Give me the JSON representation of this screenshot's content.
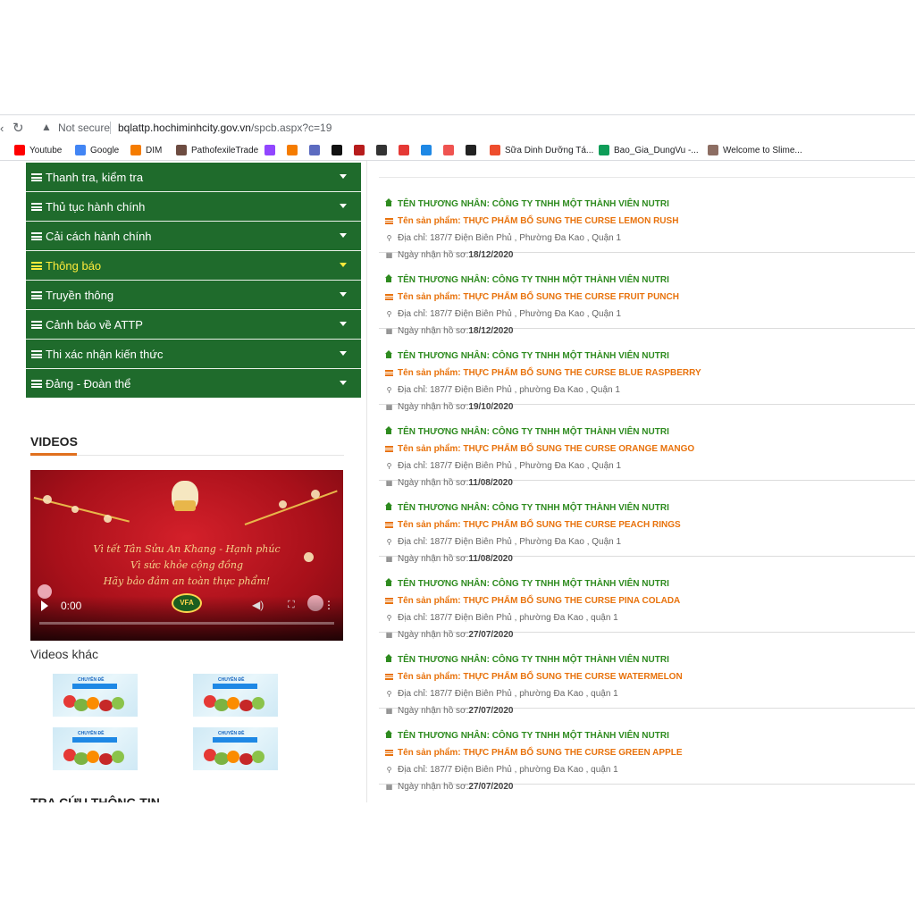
{
  "browser": {
    "not_secure": "Not secure",
    "url_host": "bqlattp.hochiminhcity.gov.vn",
    "url_path": "/spcb.aspx?c=19",
    "bookmarks": [
      {
        "label": "Youtube",
        "icon": "youtube-icon",
        "color": "#ff0000"
      },
      {
        "label": "Google",
        "icon": "google-icon",
        "color": "#4285f4"
      },
      {
        "label": "DIM",
        "icon": "dim-icon",
        "color": "#f57c00"
      },
      {
        "label": "PathofexileTrade",
        "icon": "poe-icon",
        "color": "#6d4c41"
      },
      {
        "label": "",
        "icon": "twitch-icon",
        "color": "#9146ff"
      },
      {
        "label": "",
        "icon": "g-icon",
        "color": "#f57c00"
      },
      {
        "label": "",
        "icon": "app-icon",
        "color": "#5c6bc0"
      },
      {
        "label": "",
        "icon": "c-icon",
        "color": "#111111"
      },
      {
        "label": "",
        "icon": "netflix-icon",
        "color": "#b71c1c"
      },
      {
        "label": "",
        "icon": "eye-icon",
        "color": "#333333"
      },
      {
        "label": "",
        "icon": "circle-icon",
        "color": "#e53935"
      },
      {
        "label": "",
        "icon": "h-icon",
        "color": "#1e88e5"
      },
      {
        "label": "",
        "icon": "shop-icon",
        "color": "#ef5350"
      },
      {
        "label": "",
        "icon": "github-icon",
        "color": "#222222"
      },
      {
        "label": "Sữa Dinh Dưỡng Tá...",
        "icon": "shopee-icon",
        "color": "#ee4d2d"
      },
      {
        "label": "Bao_Gia_DungVu -...",
        "icon": "sheets-icon",
        "color": "#0f9d58"
      },
      {
        "label": "Welcome to Slime...",
        "icon": "slime-icon",
        "color": "#8d6e63"
      }
    ]
  },
  "menu": [
    {
      "label": "Thanh tra, kiểm tra",
      "active": false
    },
    {
      "label": "Thủ tục hành chính",
      "active": false
    },
    {
      "label": "Cải cách hành chính",
      "active": false
    },
    {
      "label": "Thông báo",
      "active": true
    },
    {
      "label": "Truyền thông",
      "active": false
    },
    {
      "label": "Cảnh báo về ATTP",
      "active": false
    },
    {
      "label": "Thi xác nhận kiến thức",
      "active": false
    },
    {
      "label": "Đảng - Đoàn thể",
      "active": false
    }
  ],
  "videos": {
    "title": "VIDEOS",
    "video_lines": [
      "Vì tết Tân Sửu An Khang - Hạnh phúc",
      "Vì sức khỏe cộng đồng",
      "Hãy bảo đảm an toàn thực phẩm!"
    ],
    "time": "0:00",
    "logo": "VFA",
    "other_label": "Videos khác",
    "thumb_title": "CHUYÊN ĐỀ"
  },
  "lookup_title": "TRA CỨU THÔNG TIN",
  "entries": [
    {
      "merchant": "TÊN THƯƠNG NHÂN: CÔNG TY TNHH MỘT THÀNH VIÊN NUTRI",
      "product": "Tên sản phẩm: THỰC PHẨM BỔ SUNG THE CURSE LEMON RUSH",
      "address": "Địa chỉ: 187/7 Điện Biên Phủ , Phường Đa Kao , Quận 1",
      "date_label": "Ngày nhận hồ sơ: ",
      "date": "18/12/2020"
    },
    {
      "merchant": "TÊN THƯƠNG NHÂN: CÔNG TY TNHH MỘT THÀNH VIÊN NUTRI",
      "product": "Tên sản phẩm: THỰC PHẨM BỔ SUNG THE CURSE FRUIT PUNCH",
      "address": "Địa chỉ: 187/7 Điện Biên Phủ , Phường Đa Kao , Quận 1",
      "date_label": "Ngày nhận hồ sơ: ",
      "date": "18/12/2020"
    },
    {
      "merchant": "TÊN THƯƠNG NHÂN: CÔNG TY TNHH MỘT THÀNH VIÊN NUTRI",
      "product": "Tên sản phẩm: THỰC PHẨM BỔ SUNG THE CURSE BLUE RASPBERRY",
      "address": "Địa chỉ: 187/7 Điện Biên Phủ , phường Đa Kao , Quận 1",
      "date_label": "Ngày nhận hồ sơ: ",
      "date": "19/10/2020"
    },
    {
      "merchant": "TÊN THƯƠNG NHÂN: CÔNG TY TNHH MỘT THÀNH VIÊN NUTRI",
      "product": "Tên sản phẩm: THỰC PHẨM BỔ SUNG THE CURSE ORANGE MANGO",
      "address": "Địa chỉ: 187/7 Điện Biên Phủ , Phường Đa Kao , Quận 1",
      "date_label": "Ngày nhận hồ sơ: ",
      "date": "11/08/2020"
    },
    {
      "merchant": "TÊN THƯƠNG NHÂN: CÔNG TY TNHH MỘT THÀNH VIÊN NUTRI",
      "product": "Tên sản phẩm: THỰC PHẨM BỔ SUNG THE CURSE PEACH RINGS",
      "address": "Địa chỉ: 187/7 Điện Biên Phủ , Phường Đa Kao , Quận 1",
      "date_label": "Ngày nhận hồ sơ: ",
      "date": "11/08/2020"
    },
    {
      "merchant": "TÊN THƯƠNG NHÂN: CÔNG TY TNHH MỘT THÀNH VIÊN NUTRI",
      "product": "Tên sản phẩm: THỰC PHẨM BỔ SUNG THE CURSE PINA COLADA",
      "address": "Địa chỉ: 187/7 Điện Biên Phủ , phường Đa Kao , quận 1",
      "date_label": "Ngày nhận hồ sơ: ",
      "date": "27/07/2020"
    },
    {
      "merchant": "TÊN THƯƠNG NHÂN: CÔNG TY TNHH MỘT THÀNH VIÊN NUTRI",
      "product": "Tên sản phẩm: THỰC PHẨM BỔ SUNG THE CURSE WATERMELON",
      "address": "Địa chỉ: 187/7 Điện Biên Phủ , phường Đa Kao , quận 1",
      "date_label": "Ngày nhận hồ sơ: ",
      "date": "27/07/2020"
    },
    {
      "merchant": "TÊN THƯƠNG NHÂN: CÔNG TY TNHH MỘT THÀNH VIÊN NUTRI",
      "product": "Tên sản phẩm: THỰC PHẨM BỔ SUNG THE CURSE GREEN APPLE",
      "address": "Địa chỉ: 187/7 Điện Biên Phủ , phường Đa Kao , quận 1",
      "date_label": "Ngày nhận hồ sơ: ",
      "date": "27/07/2020"
    }
  ],
  "colors": {
    "menu_bg": "#1f6b2c",
    "active_menu": "#ffeb3b",
    "merchant": "#2e8b1f",
    "product": "#e8720c",
    "accent_underline": "#e0701e"
  }
}
